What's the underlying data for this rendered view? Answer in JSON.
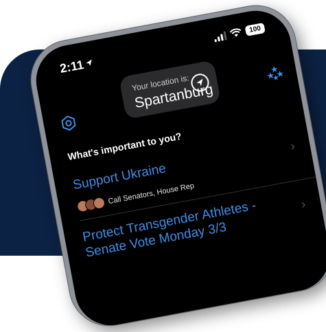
{
  "status_bar": {
    "time": "2:11",
    "battery": "100"
  },
  "location": {
    "label": "Your location is:",
    "city": "Spartanburg"
  },
  "section": {
    "title": "What's important to you?"
  },
  "issues": [
    {
      "title": "Support Ukraine",
      "subtitle": "Call Senators, House Rep"
    },
    {
      "title": "Protect Transgender Athletes - Senate Vote Monday 3/3"
    }
  ],
  "colors": {
    "background_panel": "#0c2244",
    "link": "#3d8fe8",
    "screen": "#000000"
  }
}
